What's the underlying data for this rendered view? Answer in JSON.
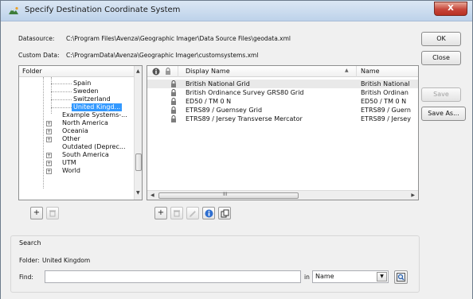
{
  "window": {
    "title": "Specify Destination Coordinate System",
    "close_label": "X"
  },
  "paths": {
    "datasource_label": "Datasource:",
    "datasource_value": "C:\\Program Files\\Avenza\\Geographic Imager\\Data Source Files\\geodata.xml",
    "custom_label": "Custom Data:",
    "custom_value": "C:\\ProgramData\\Avenza\\Geographic Imager\\customsystems.xml"
  },
  "buttons": {
    "ok": "OK",
    "close": "Close",
    "save": "Save",
    "save_as": "Save As..."
  },
  "tree": {
    "header": "Folder",
    "items": [
      {
        "label": "Spain"
      },
      {
        "label": "Sweden"
      },
      {
        "label": "Switzerland"
      },
      {
        "label": "United Kingd..."
      },
      {
        "label": "Example Systems-..."
      },
      {
        "label": "North America"
      },
      {
        "label": "Oceania"
      },
      {
        "label": "Other"
      },
      {
        "label": "Outdated (Deprec..."
      },
      {
        "label": "South America"
      },
      {
        "label": "UTM"
      },
      {
        "label": "World"
      }
    ]
  },
  "list": {
    "columns": {
      "display_name": "Display Name",
      "name": "Name"
    },
    "rows": [
      {
        "display": "British National Grid",
        "name": "British National"
      },
      {
        "display": "British Ordinance Survey GRS80 Grid",
        "name": "British Ordinan"
      },
      {
        "display": "ED50 / TM 0 N",
        "name": "ED50 / TM 0 N"
      },
      {
        "display": "ETRS89 / Guernsey Grid",
        "name": "ETRS89 / Guern"
      },
      {
        "display": "ETRS89 / Jersey Transverse Mercator",
        "name": "ETRS89 / Jersey"
      }
    ],
    "hscroll_grip": "III"
  },
  "search": {
    "group_label": "Search",
    "folder_label": "Folder:",
    "folder_value": "United Kingdom",
    "find_label": "Find:",
    "find_value": "",
    "in_label": "in",
    "in_selected": "Name"
  },
  "colors": {
    "selection": "#3399ff",
    "close_button": "#c7463a",
    "info_blue": "#2f6fd0"
  }
}
